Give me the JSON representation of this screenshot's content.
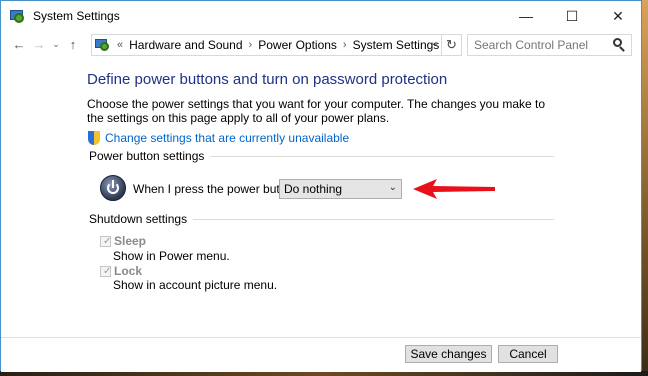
{
  "window": {
    "title": "System Settings",
    "controls": {
      "minimize": "—",
      "maximize": "☐",
      "close": "✕"
    }
  },
  "nav": {
    "back": "←",
    "forward": "→",
    "recent": "⌄",
    "up": "↑"
  },
  "address": {
    "overflow": "«",
    "crumbs": [
      "Hardware and Sound",
      "Power Options",
      "System Settings"
    ],
    "separator": "›",
    "dropdown": "⌄",
    "refresh": "↻"
  },
  "search": {
    "placeholder": "Search Control Panel"
  },
  "page": {
    "heading": "Define power buttons and turn on password protection",
    "description": "Choose the power settings that you want for your computer. The changes you make to the settings on this page apply to all of your power plans.",
    "change_link": "Change settings that are currently unavailable"
  },
  "power_group": {
    "title": "Power button settings",
    "label": "When I press the power button:",
    "selected": "Do nothing"
  },
  "shutdown_group": {
    "title": "Shutdown settings",
    "items": [
      {
        "label": "Sleep",
        "description": "Show in Power menu.",
        "checked": true
      },
      {
        "label": "Lock",
        "description": "Show in account picture menu.",
        "checked": true
      }
    ]
  },
  "buttons": {
    "save": "Save changes",
    "cancel": "Cancel"
  },
  "colors": {
    "heading": "#1e3287",
    "link": "#0066cc",
    "annotation_arrow": "#e8101a"
  }
}
